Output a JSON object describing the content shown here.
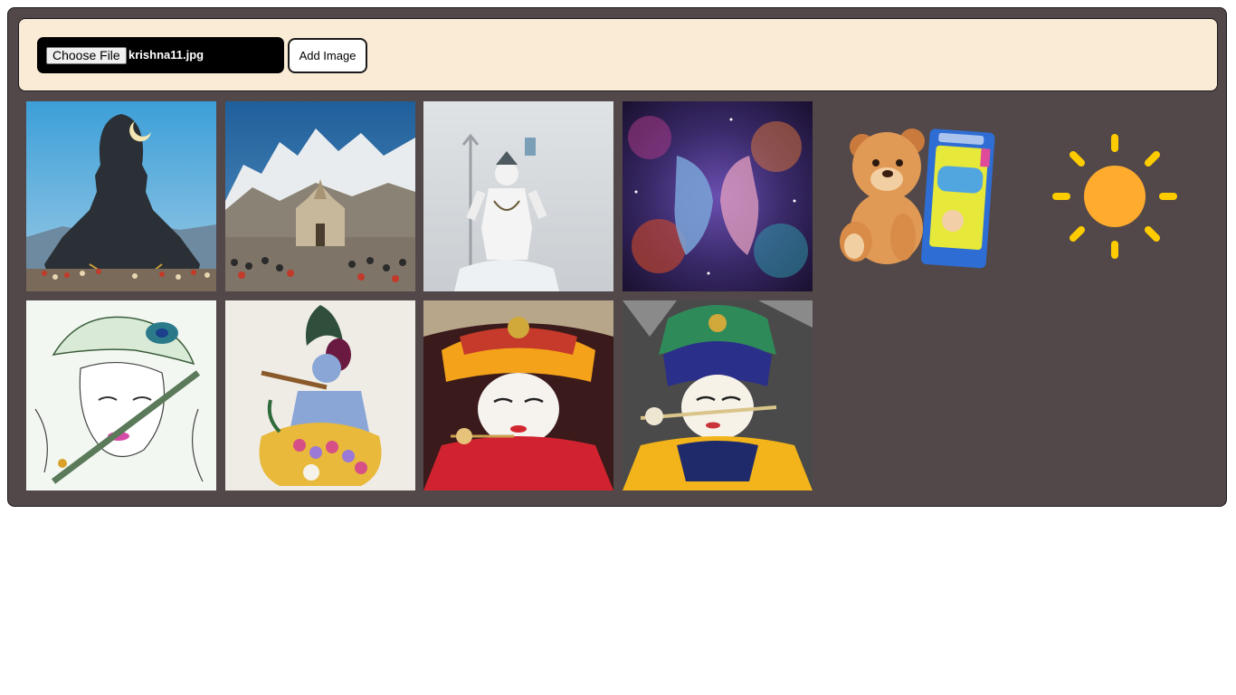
{
  "toolbar": {
    "file_input": {
      "button_label": "Choose File",
      "selected_file": "krishna11.jpg"
    },
    "add_button_label": "Add Image"
  },
  "gallery": {
    "images": [
      {
        "subject": "adiyogi-shiva-statue"
      },
      {
        "subject": "kedarnath-temple-mountains"
      },
      {
        "subject": "white-shiva-statue-trident"
      },
      {
        "subject": "cosmic-shiva-artwork"
      },
      {
        "subject": "teddy-bear-and-diaper-pack"
      },
      {
        "subject": "sun-icon"
      },
      {
        "subject": "krishna-sketch-flute"
      },
      {
        "subject": "krishna-painting-flute"
      },
      {
        "subject": "krishna-idol-orange-turban"
      },
      {
        "subject": "krishna-idol-blue-turban"
      }
    ]
  },
  "colors": {
    "panel_bg": "#524849",
    "toolbar_bg": "#faebd7",
    "sun": "#ffab2e",
    "sun_rays": "#ffcc00"
  }
}
